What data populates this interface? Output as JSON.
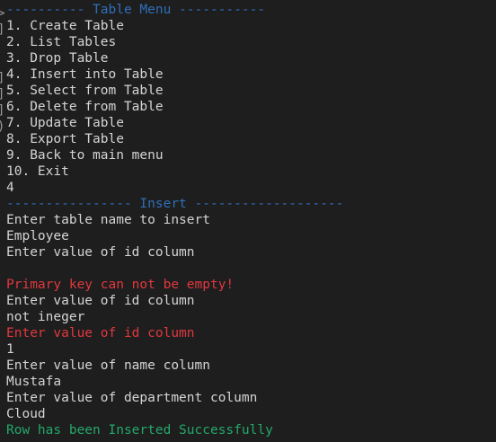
{
  "terminal": {
    "lines": [
      {
        "text": "---------- Table Menu -----------",
        "color": "#2f6fb8"
      },
      {
        "text": "1. Create Table",
        "color": "#d4d4d4"
      },
      {
        "text": "2. List Tables",
        "color": "#d4d4d4"
      },
      {
        "text": "3. Drop Table",
        "color": "#d4d4d4"
      },
      {
        "text": "4. Insert into Table",
        "color": "#d4d4d4"
      },
      {
        "text": "5. Select from Table",
        "color": "#d4d4d4"
      },
      {
        "text": "6. Delete from Table",
        "color": "#d4d4d4"
      },
      {
        "text": "7. Update Table",
        "color": "#d4d4d4"
      },
      {
        "text": "8. Export Table",
        "color": "#d4d4d4"
      },
      {
        "text": "9. Back to main menu",
        "color": "#d4d4d4"
      },
      {
        "text": "10. Exit",
        "color": "#d4d4d4"
      },
      {
        "text": "4",
        "color": "#d4d4d4"
      },
      {
        "text": "---------------- Insert -------------------",
        "color": "#2f6fb8"
      },
      {
        "text": "Enter table name to insert",
        "color": "#d4d4d4"
      },
      {
        "text": "Employee",
        "color": "#d4d4d4"
      },
      {
        "text": "Enter value of id column",
        "color": "#d4d4d4"
      },
      {
        "text": "",
        "color": "#d4d4d4"
      },
      {
        "text": "Primary key can not be empty!",
        "color": "#e0383f"
      },
      {
        "text": "Enter value of id column",
        "color": "#d4d4d4"
      },
      {
        "text": "not ineger",
        "color": "#d4d4d4"
      },
      {
        "text": "Enter value of id column",
        "color": "#e0383f"
      },
      {
        "text": "1",
        "color": "#d4d4d4"
      },
      {
        "text": "Enter value of name column",
        "color": "#d4d4d4"
      },
      {
        "text": "Mustafa",
        "color": "#d4d4d4"
      },
      {
        "text": "Enter value of department column",
        "color": "#d4d4d4"
      },
      {
        "text": "Cloud",
        "color": "#d4d4d4"
      },
      {
        "text": "Row has been Inserted Successfully",
        "color": "#23a86b"
      }
    ]
  }
}
